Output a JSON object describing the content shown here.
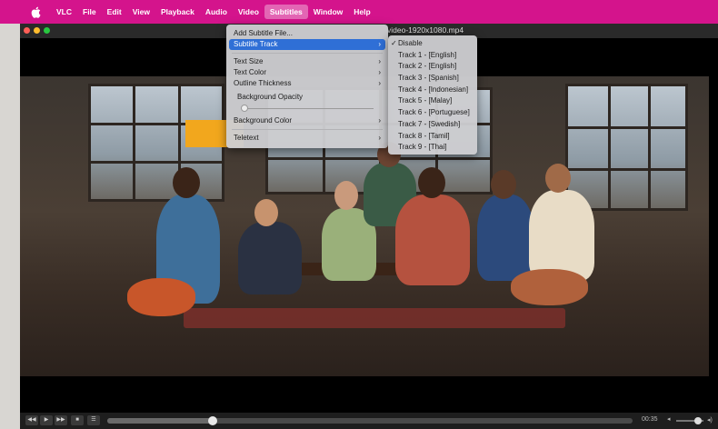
{
  "menubar": {
    "apple_icon": "apple-logo-icon",
    "items": [
      "VLC",
      "File",
      "Edit",
      "View",
      "Playback",
      "Audio",
      "Video",
      "Subtitles",
      "Window",
      "Help"
    ],
    "active": "Subtitles",
    "color": "#d4148c"
  },
  "window": {
    "title": "video-1920x1080.mp4"
  },
  "subtitles_menu": {
    "items": [
      {
        "label": "Add Subtitle File...",
        "submenu": false
      },
      {
        "label": "Subtitle Track",
        "submenu": true,
        "highlighted": true
      },
      {
        "label": "Text Size",
        "submenu": true
      },
      {
        "label": "Text Color",
        "submenu": true
      },
      {
        "label": "Outline Thickness",
        "submenu": true
      },
      {
        "label": "Background Opacity",
        "slider": true
      },
      {
        "label": "Background Color",
        "submenu": true
      },
      {
        "label": "Teletext",
        "submenu": true
      }
    ],
    "highlight_color": "#2f6fd6"
  },
  "subtitle_track_submenu": {
    "items": [
      {
        "label": "Disable",
        "checked": true
      },
      {
        "label": "Track 1 - [English]",
        "checked": false
      },
      {
        "label": "Track 2 - [English]",
        "checked": false
      },
      {
        "label": "Track 3 - [Spanish]",
        "checked": false
      },
      {
        "label": "Track 4 - [Indonesian]",
        "checked": false
      },
      {
        "label": "Track 5 - [Malay]",
        "checked": false
      },
      {
        "label": "Track 6 - [Portuguese]",
        "checked": false
      },
      {
        "label": "Track 7 - [Swedish]",
        "checked": false
      },
      {
        "label": "Track 8 - [Tamil]",
        "checked": false
      },
      {
        "label": "Track 9 - [Thai]",
        "checked": false
      }
    ]
  },
  "controller": {
    "buttons": [
      "rewind-icon",
      "play-icon",
      "fast-forward-icon",
      "stop-icon",
      "playlist-icon"
    ],
    "time": "00:35",
    "seek_fraction": 0.2,
    "volume_fraction": 0.8
  }
}
